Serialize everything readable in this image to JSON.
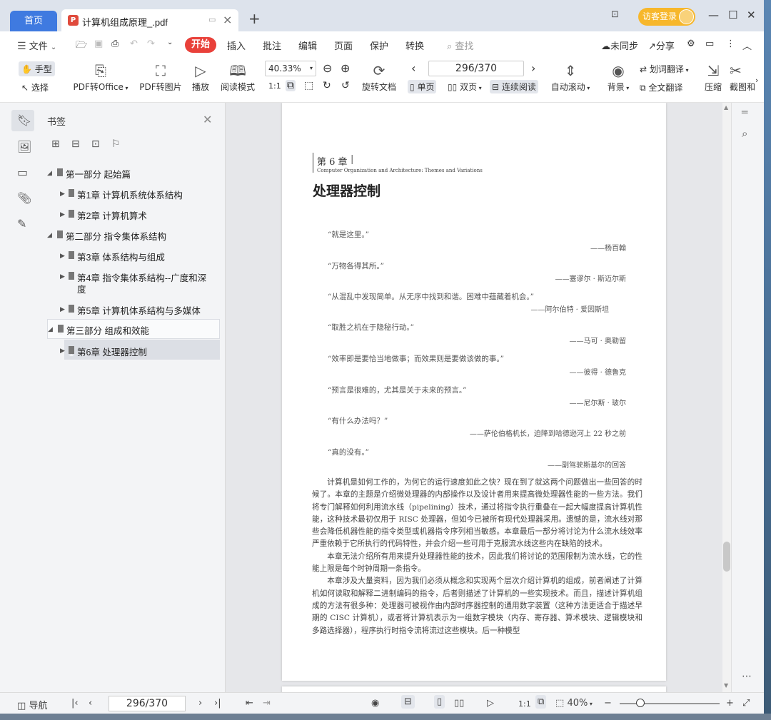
{
  "titlebar": {
    "home_tab": "首页",
    "doc_tab": "计算机组成原理_.pdf",
    "login_label": "访客登录"
  },
  "menubar": {
    "file": "文件",
    "start": "开始",
    "items": [
      "插入",
      "批注",
      "编辑",
      "页面",
      "保护",
      "转换"
    ],
    "search": "查找",
    "sync": "未同步",
    "share": "分享"
  },
  "ribbon": {
    "hand": "手型",
    "select": "选择",
    "pdf_to_office": "PDF转Office",
    "pdf_to_image": "PDF转图片",
    "play": "播放",
    "read_mode": "阅读模式",
    "zoom": "40.33%",
    "rotate": "旋转文档",
    "page_value": "296/370",
    "single": "单页",
    "double": "双页",
    "continuous": "连续阅读",
    "auto_scroll": "自动滚动",
    "background": "背景",
    "word_translate": "划词翻译",
    "full_translate": "全文翻译",
    "compress": "压缩",
    "screenshot": "截图和"
  },
  "bookmark_panel": {
    "title": "书签",
    "items": [
      {
        "label": "第一部分   起始篇"
      },
      {
        "label": "第1章  计算机系统体系结构"
      },
      {
        "label": "第2章  计算机算术"
      },
      {
        "label": "第二部分   指令集体系结构"
      },
      {
        "label": "第3章  体系结构与组成"
      },
      {
        "label": "第4章  指令集体系结构--广度和深"
      },
      {
        "label": "度"
      },
      {
        "label": "第5章  计算机体系结构与多媒体"
      },
      {
        "label": "第三部分   组成和效能"
      },
      {
        "label": "第6章  处理器控制"
      }
    ]
  },
  "document": {
    "chapter": "第 6 章",
    "chapter_sub": "Computer Organization and Architecture: Themes and Variations",
    "title": "处理器控制",
    "quotes": [
      {
        "text": "“就是这里。”",
        "author": "——杨百翰"
      },
      {
        "text": "“万物各得其所。”",
        "author": "——塞谬尔 · 斯迈尔斯"
      },
      {
        "text": "“从混乱中发现简单。从无序中找到和谐。困难中蕴藏着机会。”",
        "author": "——阿尔伯特 · 爱因斯坦"
      },
      {
        "text": "“取胜之机在于隐秘行动。”",
        "author": "——马可 · 奥勒留"
      },
      {
        "text": "“效率即是要恰当地做事；而效果则是要做该做的事。”",
        "author": "——彼得 · 德鲁克"
      },
      {
        "text": "“预言是很难的，尤其是关于未来的预言。”",
        "author": "——尼尔斯 · 玻尔"
      },
      {
        "text": "“有什么办法吗？”",
        "author": "——萨伦伯格机长，迫降到哈德逊河上 22 秒之前"
      },
      {
        "text": "“真的没有。”",
        "author": "——副驾驶斯基尔的回答"
      }
    ],
    "paragraphs": [
      "计算机是如何工作的，为何它的运行速度如此之快？现在到了就这两个问题做出一些回答的时候了。本章的主题是介绍微处理器的内部操作以及设计者用来提高微处理器性能的一些方法。我们将专门解释如何利用流水线（pipelining）技术，通过将指令执行重叠在一起大幅度提高计算机性能，这种技术最初仅用于 RISC 处理器，但如今已被所有现代处理器采用。遗憾的是，流水线对那些会降低机器性能的指令类型或机器指令序列相当敏感。本章最后一部分将讨论为什么流水线效率严重依赖于它所执行的代码特性，并会介绍一些可用于克服流水线这些内在缺陷的技术。",
      "本章无法介绍所有用来提升处理器性能的技术，因此我们将讨论的范围限制为流水线，它的性能上限是每个时钟周期一条指令。",
      "本章涉及大量资料，因为我们必须从概念和实现两个层次介绍计算机的组成，前者阐述了计算机如何读取和解释二进制编码的指令，后者则描述了计算机的一些实现技术。而且，描述计算机组成的方法有很多种：处理器可被视作由内部时序器控制的通用数字装置（这种方法更适合于描述早期的 CISC 计算机），或者将计算机表示为一组数字模块（内存、寄存器、算术模块、逻辑模块和多路选择器），程序执行时指令流将流过这些模块。后一种模型"
    ]
  },
  "status": {
    "nav": "导航",
    "page_value": "296/370",
    "zoom": "40%"
  }
}
